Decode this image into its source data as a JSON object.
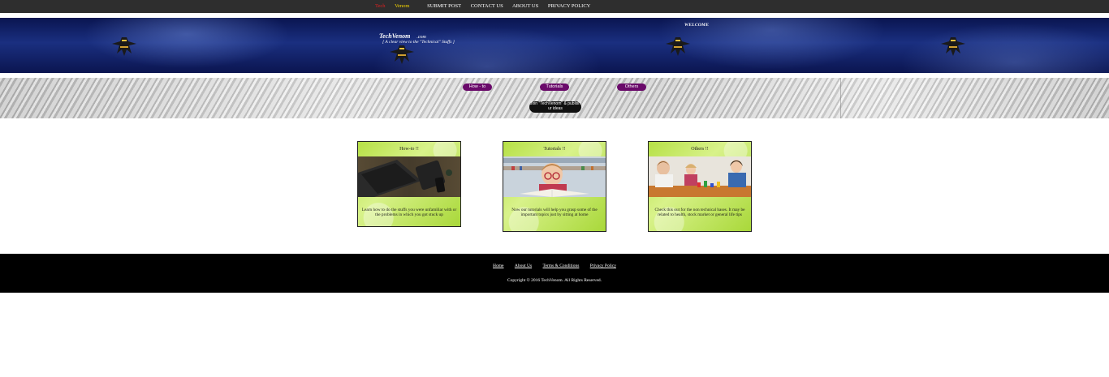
{
  "top_nav": {
    "brand_part1": "Tech",
    "brand_part2": "Venom",
    "items": [
      "SUBMIT POST",
      "CONTACT US",
      "ABOUT US",
      "PRIVACY POLICY"
    ]
  },
  "banner": {
    "title": "TechVenom",
    "dotcom": ".com",
    "tagline": "[ A clear view to the \"Technical\" Stuffs ]",
    "welcome": "WELCOME",
    "ninja_icon": "ninja-logo-icon"
  },
  "categories": {
    "buttons": [
      "How - to",
      "Tutorials",
      "Others"
    ],
    "join": "Join \"TechVenom\" & publish ur ideas"
  },
  "cards": [
    {
      "title": "How-to !!",
      "description": "Learn how to do the stuffs you were unfamiliar with or the problems in which you got stuck up",
      "image": "laptop-tablet-phone-photo"
    },
    {
      "title": "Tutorials !!",
      "description": "Now our tutorials will help you grasp some of the important topics just by sitting at home",
      "image": "child-reading-book-photo"
    },
    {
      "title": "Others !!",
      "description": "Check this out for the non technical bases. It may be related to health, stock market or general life tips",
      "image": "family-playing-game-photo"
    }
  ],
  "footer": {
    "links": [
      "Home",
      "About Us",
      "Terms & Conditions",
      "Privacy Policy"
    ],
    "copyright": "Copyright © 2016 TechVenom.  All Rights Reserved."
  },
  "colors": {
    "top_nav_bg": "#2e2e2e",
    "brand_tech": "#e02020",
    "brand_venom": "#f5d400",
    "banner_bg": "#1a2f80",
    "pill_bg": "#6a0a6a",
    "card_bg": "#b6e046",
    "footer_bg": "#000000"
  }
}
